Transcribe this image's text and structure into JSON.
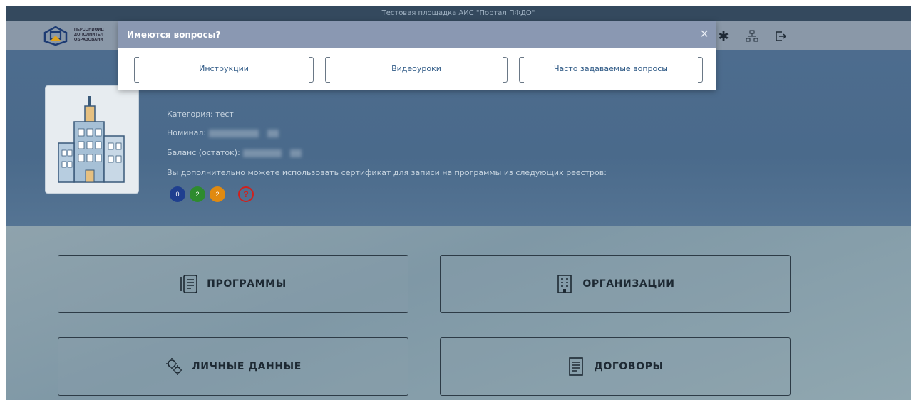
{
  "topbar": {
    "text": "Тестовая площадка АИС \"Портал ПФДО\""
  },
  "header": {
    "logo_lines": [
      "ПЕРСОНИФИЦ",
      "ДОПОЛНИТЕЛ",
      "ОБРАЗОВАНИ"
    ],
    "icons": [
      "asterisk-icon",
      "org-chart-icon",
      "logout-icon"
    ]
  },
  "profile": {
    "category": "Категория: тест",
    "nominal_label": "Номинал:",
    "balance_label": "Баланс (остаток):",
    "registry_note": "Вы дополнительно можете использовать сертификат для записи на программы из следующих реестров:",
    "badges": [
      {
        "label": "0",
        "color": "#1f3f8f"
      },
      {
        "label": "2",
        "color": "#2e8b2e"
      },
      {
        "label": "2",
        "color": "#e08a10"
      },
      {
        "label": "?",
        "color": "#d0201c"
      }
    ]
  },
  "tiles": {
    "programs": "ПРОГРАММЫ",
    "organizations": "ОРГАНИЗАЦИИ",
    "personal": "ЛИЧНЫЕ ДАННЫЕ",
    "contracts": "ДОГОВОРЫ"
  },
  "modal": {
    "title": "Имеются вопросы?",
    "close": "×",
    "buttons": [
      "Инструкции",
      "Видеоуроки",
      "Часто задаваемые вопросы"
    ]
  }
}
